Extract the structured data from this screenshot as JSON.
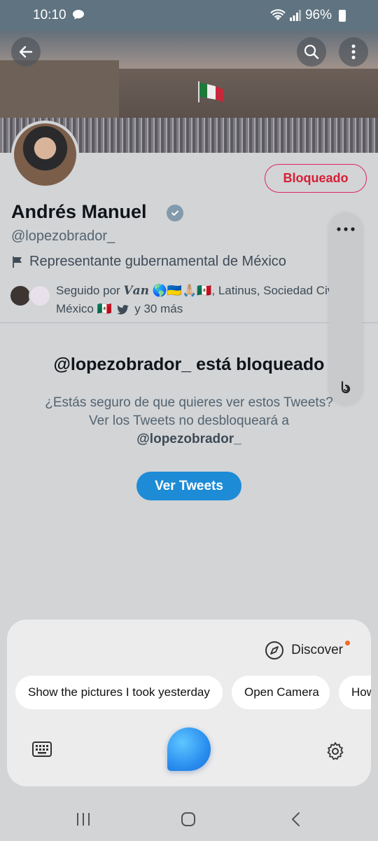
{
  "status_bar": {
    "time": "10:10",
    "battery": "96%"
  },
  "profile": {
    "name": "Andrés Manuel",
    "handle": "@lopezobrador_",
    "affiliation": "Representante gubernamental de México",
    "followed_by_prefix": "Seguido por",
    "followed_by_name": "𝑽𝒂𝒏",
    "followed_by_emoji": "🌎🇺🇦🙏🏼🇲🇽",
    "followed_by_rest": ", Latinus, Sociedad Civil México 🇲🇽",
    "followed_by_suffix": "y 30 más",
    "blocked_button": "Bloqueado"
  },
  "blocked_notice": {
    "title": "@lopezobrador_ está bloqueado",
    "body": "¿Estás seguro de que quieres ver estos Tweets? Ver los Tweets no desbloqueará a",
    "body_handle": "@lopezobrador_",
    "view_button": "Ver Tweets"
  },
  "bixby": {
    "discover_label": "Discover",
    "chips": [
      "Show the pictures I took yesterday",
      "Open Camera",
      "How"
    ]
  },
  "colors": {
    "blocked_red": "#d81e34",
    "accent_blue": "#1d8bd6",
    "discover_dot": "#f26a22"
  }
}
